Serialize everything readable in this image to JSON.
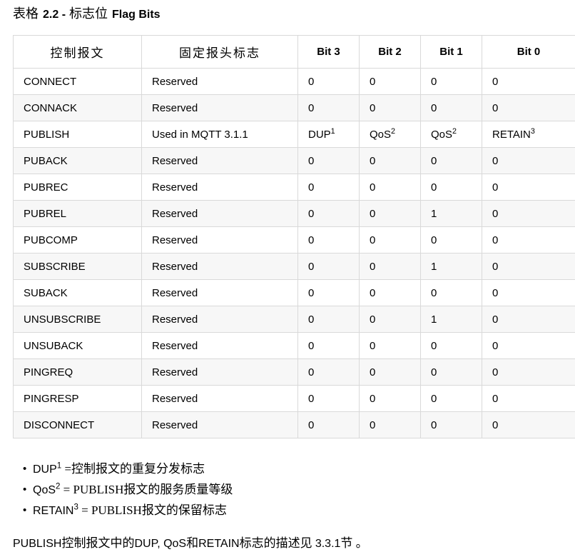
{
  "title": {
    "prefix_cjk": "表格",
    "number": "2.2 -",
    "label_cjk": "标志位",
    "label_latin": "Flag Bits"
  },
  "table": {
    "headers": {
      "control_packet": "控制报文",
      "fixed_header_flags": "固定报头标志",
      "bit3": "Bit 3",
      "bit2": "Bit 2",
      "bit1": "Bit 1",
      "bit0": "Bit 0"
    },
    "rows": [
      {
        "name": "CONNECT",
        "flags": "Reserved",
        "b3": "0",
        "b3sup": "",
        "b2": "0",
        "b2sup": "",
        "b1": "0",
        "b1sup": "",
        "b0": "0",
        "b0sup": ""
      },
      {
        "name": "CONNACK",
        "flags": "Reserved",
        "b3": "0",
        "b3sup": "",
        "b2": "0",
        "b2sup": "",
        "b1": "0",
        "b1sup": "",
        "b0": "0",
        "b0sup": ""
      },
      {
        "name": "PUBLISH",
        "flags": "Used in MQTT 3.1.1",
        "b3": "DUP",
        "b3sup": "1",
        "b2": "QoS",
        "b2sup": "2",
        "b1": "QoS",
        "b1sup": "2",
        "b0": "RETAIN",
        "b0sup": "3"
      },
      {
        "name": "PUBACK",
        "flags": "Reserved",
        "b3": "0",
        "b3sup": "",
        "b2": "0",
        "b2sup": "",
        "b1": "0",
        "b1sup": "",
        "b0": "0",
        "b0sup": ""
      },
      {
        "name": "PUBREC",
        "flags": "Reserved",
        "b3": "0",
        "b3sup": "",
        "b2": "0",
        "b2sup": "",
        "b1": "0",
        "b1sup": "",
        "b0": "0",
        "b0sup": ""
      },
      {
        "name": "PUBREL",
        "flags": "Reserved",
        "b3": "0",
        "b3sup": "",
        "b2": "0",
        "b2sup": "",
        "b1": "1",
        "b1sup": "",
        "b0": "0",
        "b0sup": ""
      },
      {
        "name": "PUBCOMP",
        "flags": "Reserved",
        "b3": "0",
        "b3sup": "",
        "b2": "0",
        "b2sup": "",
        "b1": "0",
        "b1sup": "",
        "b0": "0",
        "b0sup": ""
      },
      {
        "name": "SUBSCRIBE",
        "flags": "Reserved",
        "b3": "0",
        "b3sup": "",
        "b2": "0",
        "b2sup": "",
        "b1": "1",
        "b1sup": "",
        "b0": "0",
        "b0sup": ""
      },
      {
        "name": "SUBACK",
        "flags": "Reserved",
        "b3": "0",
        "b3sup": "",
        "b2": "0",
        "b2sup": "",
        "b1": "0",
        "b1sup": "",
        "b0": "0",
        "b0sup": ""
      },
      {
        "name": "UNSUBSCRIBE",
        "flags": "Reserved",
        "b3": "0",
        "b3sup": "",
        "b2": "0",
        "b2sup": "",
        "b1": "1",
        "b1sup": "",
        "b0": "0",
        "b0sup": ""
      },
      {
        "name": "UNSUBACK",
        "flags": "Reserved",
        "b3": "0",
        "b3sup": "",
        "b2": "0",
        "b2sup": "",
        "b1": "0",
        "b1sup": "",
        "b0": "0",
        "b0sup": ""
      },
      {
        "name": "PINGREQ",
        "flags": "Reserved",
        "b3": "0",
        "b3sup": "",
        "b2": "0",
        "b2sup": "",
        "b1": "0",
        "b1sup": "",
        "b0": "0",
        "b0sup": ""
      },
      {
        "name": "PINGRESP",
        "flags": "Reserved",
        "b3": "0",
        "b3sup": "",
        "b2": "0",
        "b2sup": "",
        "b1": "0",
        "b1sup": "",
        "b0": "0",
        "b0sup": ""
      },
      {
        "name": "DISCONNECT",
        "flags": "Reserved",
        "b3": "0",
        "b3sup": "",
        "b2": "0",
        "b2sup": "",
        "b1": "0",
        "b1sup": "",
        "b0": "0",
        "b0sup": ""
      }
    ]
  },
  "notes": {
    "bullet_glyph": "•",
    "items": [
      {
        "term": "DUP",
        "sup": "1",
        "desc": " =控制报文的重复分发标志"
      },
      {
        "term": "QoS",
        "sup": "2",
        "desc": " = PUBLISH报文的服务质量等级"
      },
      {
        "term": "RETAIN",
        "sup": "3",
        "desc": " = PUBLISH报文的保留标志"
      }
    ]
  },
  "closing": {
    "text_a": "PUBLISH",
    "text_b": "控制报文中的",
    "text_c": "DUP, QoS",
    "text_d": "和",
    "text_e": "RETAIN",
    "text_f": "标志的描述见 ",
    "text_g": "3.3.1",
    "text_h": "节 。"
  },
  "colors": {
    "border": "#d9d9d9",
    "stripe": "#f7f7f7",
    "background": "#ffffff",
    "text": "#000000"
  }
}
